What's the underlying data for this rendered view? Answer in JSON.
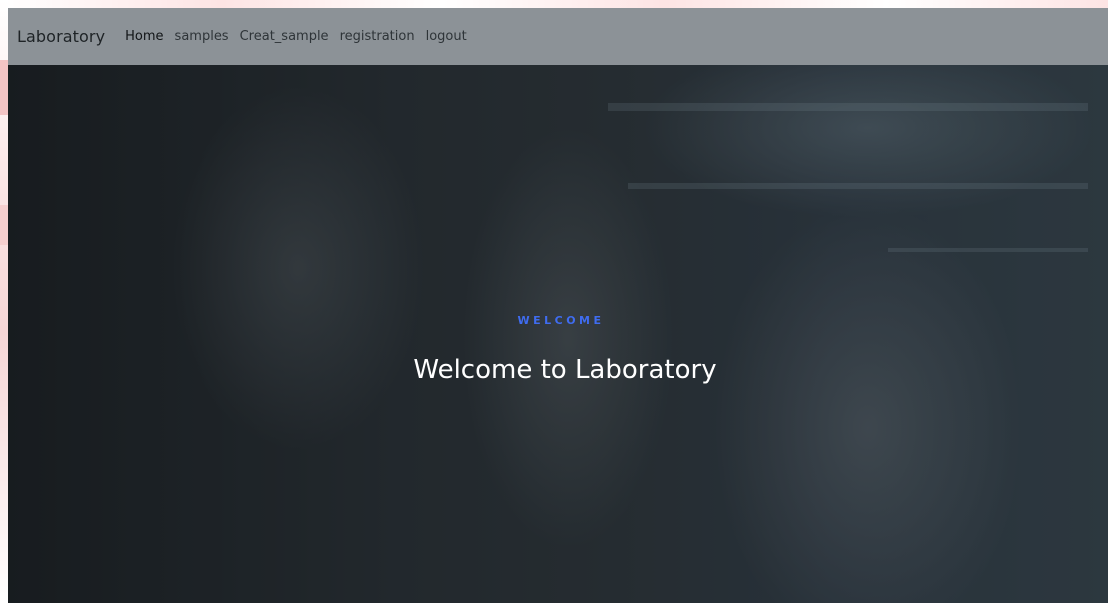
{
  "navbar": {
    "brand": "Laboratory",
    "links": [
      {
        "label": "Home",
        "active": true
      },
      {
        "label": "samples",
        "active": false
      },
      {
        "label": "Creat_sample",
        "active": false
      },
      {
        "label": "registration",
        "active": false
      },
      {
        "label": "logout",
        "active": false
      }
    ]
  },
  "hero": {
    "eyebrow": "WELCOME",
    "headline": "Welcome to Laboratory"
  },
  "colors": {
    "navbar_bg": "#8c9297",
    "eyebrow": "#3f6cf0",
    "headline": "#ffffff"
  }
}
